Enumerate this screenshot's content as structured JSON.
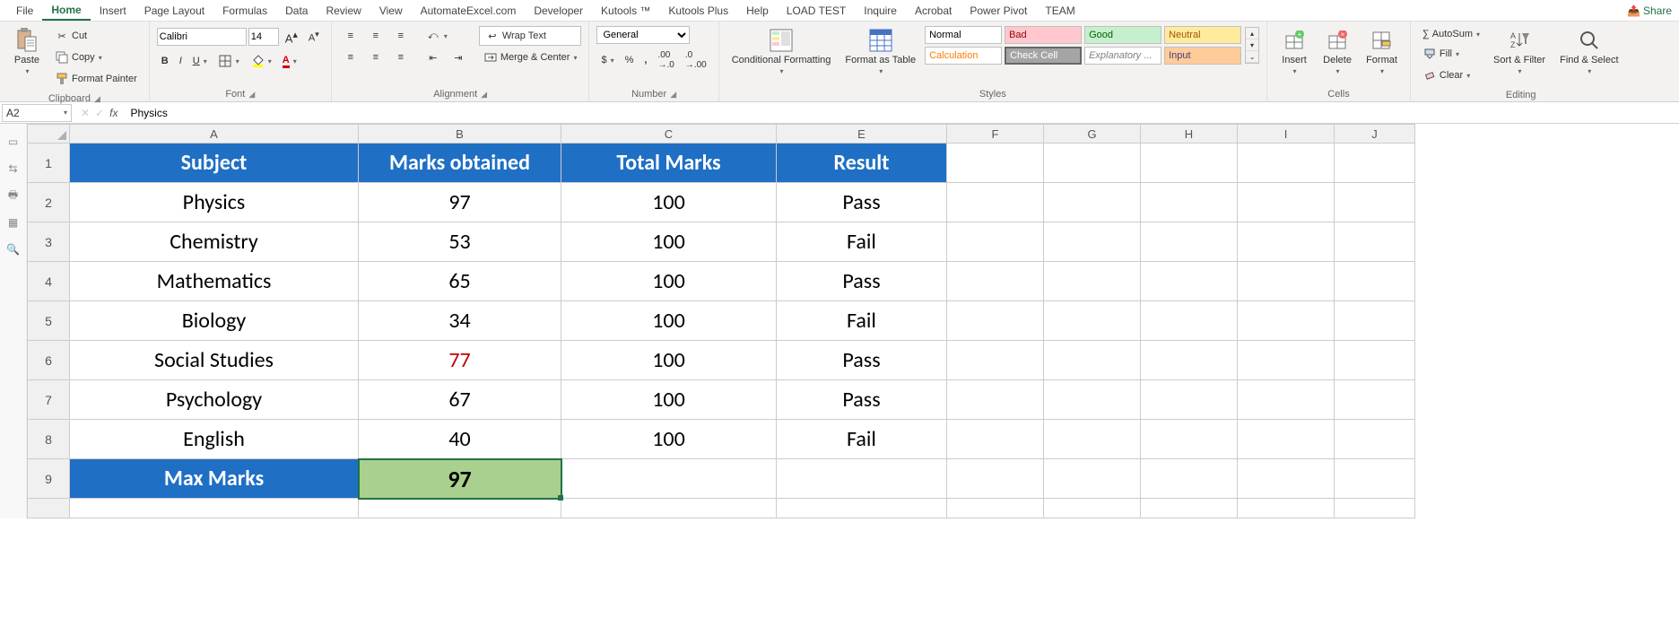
{
  "menubar": {
    "items": [
      "File",
      "Home",
      "Insert",
      "Page Layout",
      "Formulas",
      "Data",
      "Review",
      "View",
      "AutomateExcel.com",
      "Developer",
      "Kutools ™",
      "Kutools Plus",
      "Help",
      "LOAD TEST",
      "Inquire",
      "Acrobat",
      "Power Pivot",
      "TEAM"
    ],
    "active": "Home",
    "share": "Share"
  },
  "clipboard": {
    "paste": "Paste",
    "cut": "Cut",
    "copy": "Copy",
    "painter": "Format Painter",
    "label": "Clipboard"
  },
  "font": {
    "name": "Calibri",
    "size": "14",
    "label": "Font"
  },
  "alignment": {
    "wrap": "Wrap Text",
    "merge": "Merge & Center",
    "label": "Alignment"
  },
  "number": {
    "format": "General",
    "label": "Number"
  },
  "styles": {
    "cond": "Conditional Formatting",
    "table": "Format as Table",
    "cells": [
      "Normal",
      "Bad",
      "Good",
      "Neutral",
      "Calculation",
      "Check Cell",
      "Explanatory ...",
      "Input"
    ],
    "label": "Styles"
  },
  "cells": {
    "insert": "Insert",
    "delete": "Delete",
    "format": "Format",
    "label": "Cells"
  },
  "editing": {
    "sum": "AutoSum",
    "fill": "Fill",
    "clear": "Clear",
    "sort": "Sort & Filter",
    "find": "Find & Select",
    "label": "Editing"
  },
  "namebox": "A2",
  "formula": "Physics",
  "columns": [
    "A",
    "B",
    "C",
    "E",
    "F",
    "G",
    "H",
    "I",
    "J"
  ],
  "rownums": [
    "1",
    "2",
    "3",
    "4",
    "5",
    "6",
    "7",
    "8",
    "9"
  ],
  "headers": {
    "A": "Subject",
    "B": "Marks obtained",
    "C": "Total Marks",
    "E": "Result"
  },
  "data": [
    {
      "A": "Physics",
      "B": "97",
      "C": "100",
      "E": "Pass"
    },
    {
      "A": "Chemistry",
      "B": "53",
      "C": "100",
      "E": "Fail"
    },
    {
      "A": "Mathematics",
      "B": "65",
      "C": "100",
      "E": "Pass"
    },
    {
      "A": "Biology",
      "B": "34",
      "C": "100",
      "E": "Fail"
    },
    {
      "A": "Social Studies",
      "B": "77",
      "C": "100",
      "E": "Pass",
      "redB": true
    },
    {
      "A": "Psychology",
      "B": "67",
      "C": "100",
      "E": "Pass"
    },
    {
      "A": "English",
      "B": "40",
      "C": "100",
      "E": "Fail"
    }
  ],
  "footer": {
    "A": "Max Marks",
    "B": "97"
  }
}
